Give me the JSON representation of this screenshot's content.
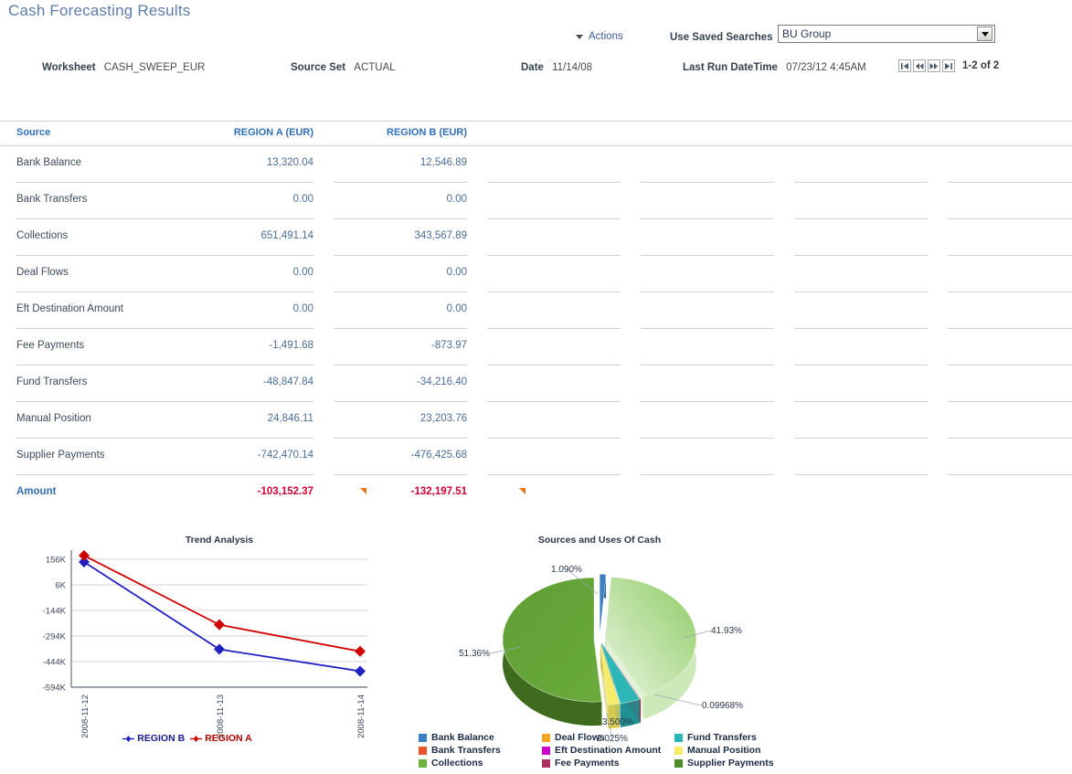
{
  "page_title": "Cash Forecasting Results",
  "toolbar": {
    "actions_label": "Actions",
    "saved_searches_label": "Use Saved Searches",
    "saved_search_value": "BU Group"
  },
  "meta": {
    "worksheet_label": "Worksheet",
    "worksheet_value": "CASH_SWEEP_EUR",
    "source_set_label": "Source Set",
    "source_set_value": "ACTUAL",
    "date_label": "Date",
    "date_value": "11/14/08",
    "last_run_label": "Last Run DateTime",
    "last_run_value": "07/23/12  4:45AM"
  },
  "pager": {
    "count_text": "1-2 of 2",
    "first_title": "First",
    "prev_title": "Previous",
    "next_title": "Next",
    "last_title": "Last"
  },
  "grid": {
    "columns": [
      "Source",
      "REGION A (EUR)",
      "REGION B (EUR)"
    ],
    "rows": [
      {
        "source": "Bank Balance",
        "a": "13,320.04",
        "b": "12,546.89"
      },
      {
        "source": "Bank Transfers",
        "a": "0.00",
        "b": "0.00"
      },
      {
        "source": "Collections",
        "a": "651,491.14",
        "b": "343,567.89"
      },
      {
        "source": "Deal Flows",
        "a": "0.00",
        "b": "0.00"
      },
      {
        "source": "Eft Destination Amount",
        "a": "0.00",
        "b": "0.00"
      },
      {
        "source": "Fee Payments",
        "a": "-1,491.68",
        "b": "-873.97"
      },
      {
        "source": "Fund Transfers",
        "a": "-48,847.84",
        "b": "-34,216.40"
      },
      {
        "source": "Manual Position",
        "a": "24,846.11",
        "b": "23,203.76"
      },
      {
        "source": "Supplier Payments",
        "a": "-742,470.14",
        "b": "-476,425.68"
      }
    ],
    "total": {
      "source": "Amount",
      "a": "-103,152.37",
      "b": "-132,197.51"
    }
  },
  "chart_data": [
    {
      "type": "line",
      "title": "Trend Analysis",
      "xlabel": "",
      "ylabel": "",
      "categories": [
        "2008-11-12",
        "2008-11-13",
        "2008-11-14"
      ],
      "yticks": [
        "156K",
        "6K",
        "-144K",
        "-294K",
        "-444K",
        "-594K"
      ],
      "ytick_values": [
        156000,
        6000,
        -144000,
        -294000,
        -444000,
        -594000
      ],
      "ylim": [
        -594000,
        156000
      ],
      "grid": true,
      "legend_position": "bottom",
      "series": [
        {
          "name": "REGION B",
          "color": "#2020c0",
          "values": [
            140000,
            -372000,
            -500000
          ]
        },
        {
          "name": "REGION A",
          "color": "#d00000",
          "values": [
            178000,
            -228000,
            -384000
          ]
        }
      ]
    },
    {
      "type": "pie",
      "title": "Sources and Uses Of Cash",
      "legend_position": "bottom",
      "labels": [
        "Bank Balance",
        "Bank Transfers",
        "Collections",
        "Deal Flows",
        "Eft Destination Amount",
        "Fee Payments",
        "Fund Transfers",
        "Manual Position",
        "Supplier Payments"
      ],
      "colors": [
        "#3a7fc1",
        "#e8542b",
        "#6db33f",
        "#f5a623",
        "#cc00cc",
        "#b03060",
        "#2cb6b6",
        "#f6ec6a",
        "#4c8c2b"
      ],
      "values": [
        1.09,
        0.0,
        41.93,
        0.0,
        0.0,
        0.09968,
        3.5,
        2.025,
        51.36
      ],
      "value_labels": [
        "1.090%",
        "41.93%",
        "0.09968%",
        "3.500%",
        "2.025%",
        "51.36%"
      ],
      "visible_slices": [
        {
          "label": "Bank Balance",
          "value": 1.09,
          "text": "1.090%",
          "color": "#3a7fc1"
        },
        {
          "label": "Collections",
          "value": 41.93,
          "text": "41.93%",
          "color": "#6db33f"
        },
        {
          "label": "Fee Payments",
          "value": 0.09968,
          "text": "0.09968%",
          "color": "#b03060"
        },
        {
          "label": "Fund Transfers",
          "value": 3.5,
          "text": "3.500%",
          "color": "#2cb6b6"
        },
        {
          "label": "Manual Position",
          "value": 2.025,
          "text": "2.025%",
          "color": "#f6ec6a"
        },
        {
          "label": "Supplier Payments",
          "value": 51.36,
          "text": "51.36%",
          "color": "#4c8c2b"
        }
      ]
    }
  ]
}
